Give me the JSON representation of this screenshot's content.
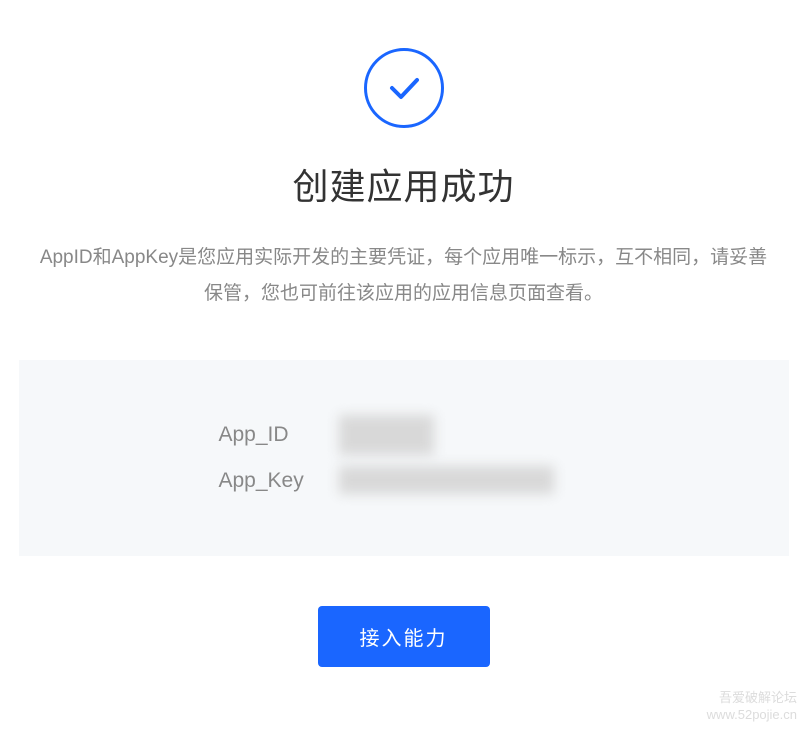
{
  "icon": {
    "name": "success-checkmark",
    "color": "#1a66ff"
  },
  "title": "创建应用成功",
  "description": "AppID和AppKey是您应用实际开发的主要凭证，每个应用唯一标示，互不相同，请妥善保管，您也可前往该应用的应用信息页面查看。",
  "credentials": {
    "app_id": {
      "label": "App_ID",
      "value_obscured": true
    },
    "app_key": {
      "label": "App_Key",
      "value_obscured": true
    }
  },
  "action": {
    "primary_label": "接入能力"
  },
  "watermark": {
    "line1": "吾爱破解论坛",
    "line2": "www.52pojie.cn"
  }
}
